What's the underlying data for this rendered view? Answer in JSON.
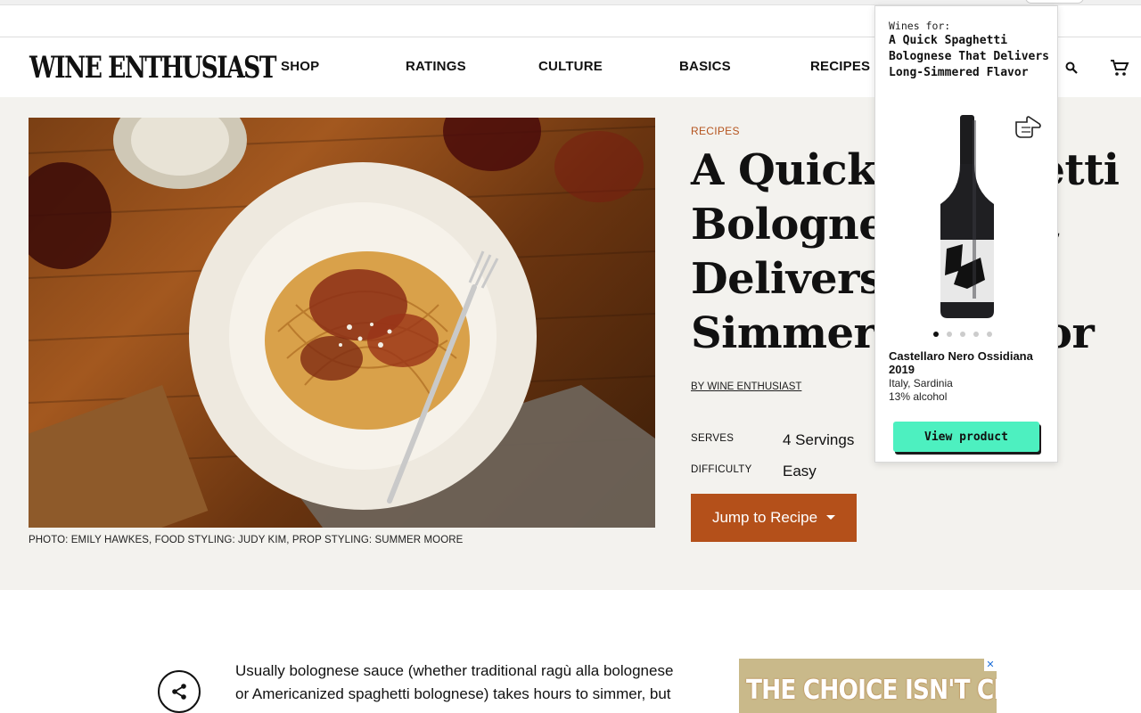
{
  "header": {
    "logo": "WINE ENTHUSIAST",
    "nav": [
      "SHOP",
      "RATINGS",
      "CULTURE",
      "BASICS",
      "RECIPES"
    ]
  },
  "hero": {
    "photo_caption": "PHOTO: EMILY HAWKES, FOOD STYLING: JUDY KIM, PROP STYLING: SUMMER MOORE",
    "category": "RECIPES",
    "title_lines": [
      "A Quick Spaghetti",
      "Bolognese That",
      "Delivers Long-",
      "Simmered Flavor"
    ],
    "byline": "BY WINE ENTHUSIAST",
    "serves_label": "SERVES",
    "serves_value": "4 Servings",
    "difficulty_label": "DIFFICULTY",
    "difficulty_value": "Easy",
    "jump_label": "Jump to Recipe"
  },
  "body": {
    "lines": [
      "Usually bolognese sauce (whether traditional ragù alla bolognese",
      "or Americanized spaghetti bolognese) takes hours to simmer, but"
    ]
  },
  "ad": {
    "text": "THE CHOICE ISN'T CLEAR.",
    "close": "✕"
  },
  "popup": {
    "for_label": "Wines for:",
    "title": "A Quick Spaghetti Bolognese That Delivers Long-Simmered Flavor",
    "wine_name": "Castellaro Nero Ossidiana 2019",
    "region": "Italy, Sardinia",
    "abv": "13% alcohol",
    "button": "View product",
    "carousel_count": 5,
    "carousel_active": 0
  },
  "colors": {
    "accent": "#b4501a",
    "hero_bg": "#f3f2ee",
    "popup_button": "#4df0c0"
  }
}
